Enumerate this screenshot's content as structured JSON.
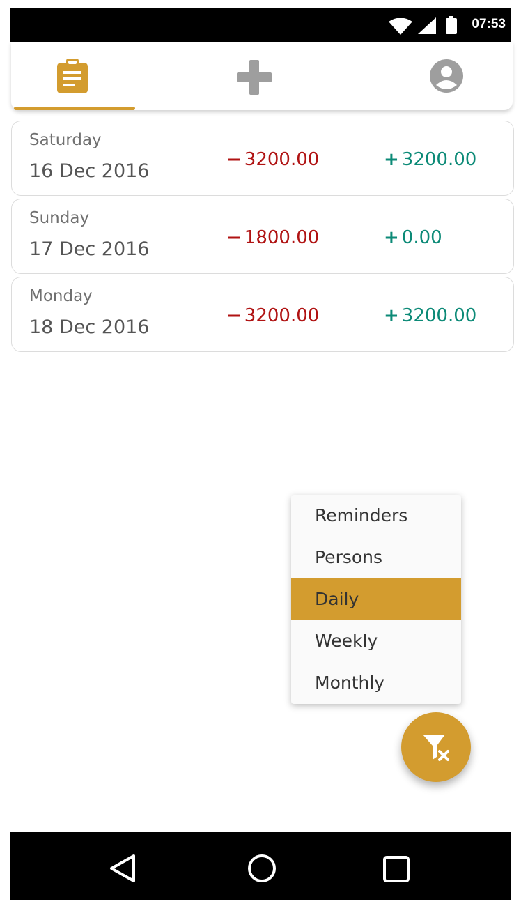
{
  "status_bar": {
    "time": "07:53",
    "icons": [
      "wifi-icon",
      "signal-icon",
      "battery-icon"
    ]
  },
  "tabs": [
    {
      "name": "clipboard-list-icon",
      "selected": true
    },
    {
      "name": "plus-icon",
      "selected": false
    },
    {
      "name": "account-circle-icon",
      "selected": false
    }
  ],
  "colors": {
    "accent": "#d39c2f",
    "debit": "#b01313",
    "credit": "#0c8a77",
    "tab_inactive": "#9e9e9e"
  },
  "days": [
    {
      "weekday": "Saturday",
      "date": "16 Dec 2016",
      "debit_sign": "−",
      "debit": "3200.00",
      "credit_sign": "+",
      "credit": "3200.00"
    },
    {
      "weekday": "Sunday",
      "date": "17 Dec 2016",
      "debit_sign": "−",
      "debit": "1800.00",
      "credit_sign": "+",
      "credit": "0.00"
    },
    {
      "weekday": "Monday",
      "date": "18 Dec 2016",
      "debit_sign": "−",
      "debit": "3200.00",
      "credit_sign": "+",
      "credit": "3200.00"
    }
  ],
  "menu": {
    "items": [
      {
        "label": "Reminders"
      },
      {
        "label": "Persons"
      },
      {
        "label": "Daily"
      },
      {
        "label": "Weekly"
      },
      {
        "label": "Monthly"
      }
    ],
    "selected": "Daily"
  },
  "fab": {
    "icon": "filter-remove-icon"
  },
  "nav_bar": {
    "icons": [
      "back-icon",
      "home-icon",
      "recents-icon"
    ]
  }
}
